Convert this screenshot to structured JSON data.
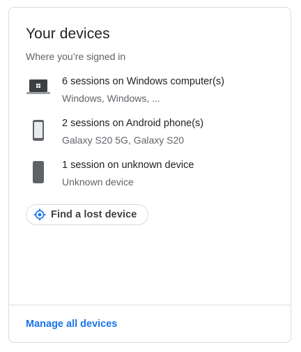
{
  "card": {
    "title": "Your devices",
    "subtitle": "Where you’re signed in"
  },
  "devices": [
    {
      "icon": "laptop-icon",
      "name": "6 sessions on Windows computer(s)",
      "detail": "Windows, Windows, ..."
    },
    {
      "icon": "phone-icon",
      "name": "2 sessions on Android phone(s)",
      "detail": "Galaxy S20 5G, Galaxy S20"
    },
    {
      "icon": "phone-icon",
      "name": "1 session on unknown device",
      "detail": "Unknown device"
    }
  ],
  "find_button": {
    "label": "Find a lost device",
    "icon": "location-target-icon"
  },
  "manage_link": {
    "label": "Manage all devices"
  },
  "colors": {
    "link": "#1a73e8",
    "text_primary": "#202124",
    "text_secondary": "#5f6368",
    "border": "#dadce0"
  }
}
